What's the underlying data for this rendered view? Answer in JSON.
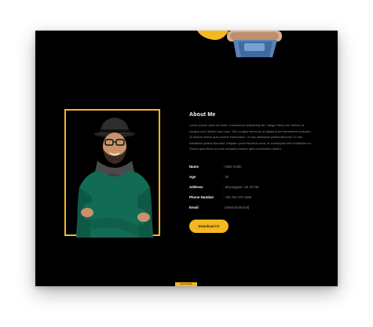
{
  "colors": {
    "accent": "#f5b81f",
    "background": "#000000",
    "text_primary": "#ffffff",
    "text_muted": "#8a8a8a"
  },
  "about": {
    "title": "About Me",
    "paragraph": "Lorem ipsum dolor sit amet, consectetur adipiscing elit. Integer tellus est, finibus ut congue sed, dictum nec nunc. Sed congue est eros, et dapibus leo elementum posuere. Ut dictum metus quis laoreet elementum. In hac habitasse platea dictumst. In hac habitasse platea dictumst. Aliquam porta faucibus urna, et consequat velit vestibulum in. Donec quis tellus ut urna volutpat posuere quis consectetur ipsum."
  },
  "info": [
    {
      "label": "Name",
      "value": ": Mark Smith"
    },
    {
      "label": "Age",
      "value": ": 30"
    },
    {
      "label": "Address",
      "value": ": Shivangpuri, UK 91730"
    },
    {
      "label": "Phone Number",
      "value": ": +00 753 270 4466"
    },
    {
      "label": "Email",
      "value": ": [email protected]"
    }
  ],
  "download_button": {
    "label": "Download CV"
  },
  "bottom_tab": {
    "label": "SHOW MORE"
  },
  "icons": {
    "portrait": "person-portrait-image",
    "banner": "crossed-arms-image"
  }
}
